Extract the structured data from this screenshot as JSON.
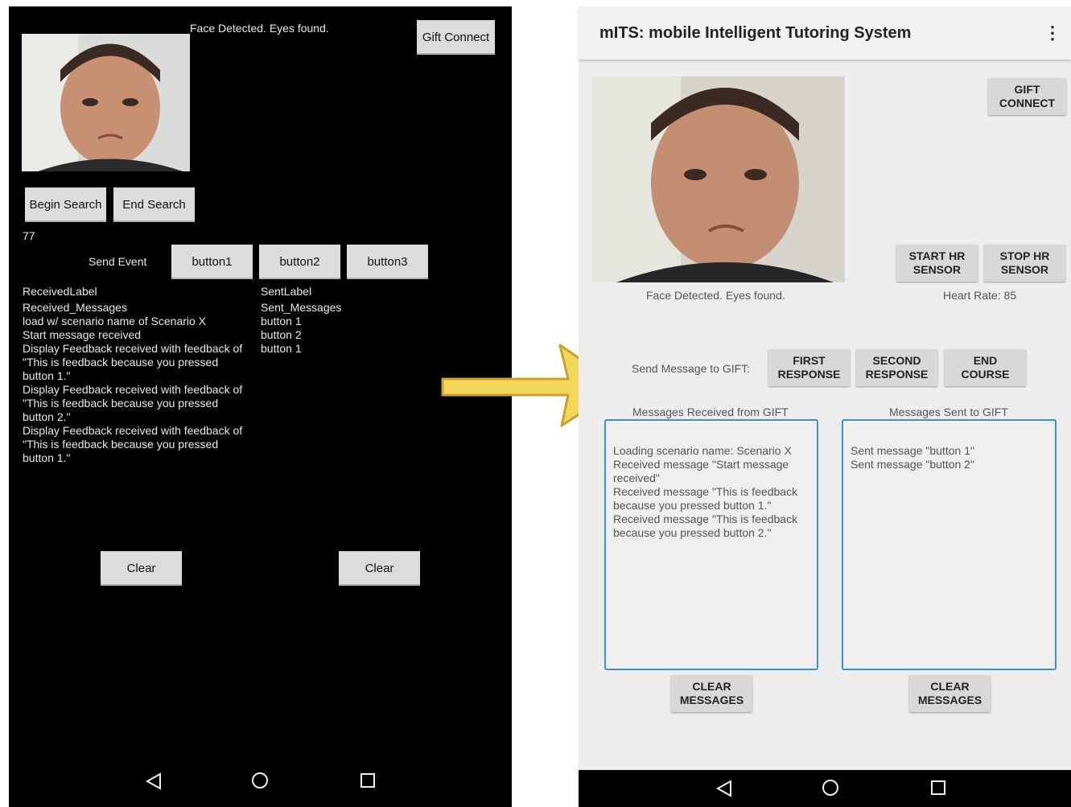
{
  "old_screen": {
    "status": "Face Detected. Eyes found.",
    "gift_connect": "Gift Connect",
    "begin_search": "Begin Search",
    "end_search": "End Search",
    "counter": "77",
    "send_event_label": "Send Event",
    "buttons": [
      "button1",
      "button2",
      "button3"
    ],
    "received_label": "ReceivedLabel",
    "received_lines": [
      "Received_Messages",
      "load w/ scenario name of Scenario X",
      "Start message received",
      "Display Feedback received with feedback of",
      "\"This is feedback because you pressed",
      "button 1.\"",
      "Display Feedback received with feedback of",
      "\"This is feedback because you pressed",
      "button 2.\"",
      "Display Feedback received with feedback of",
      "\"This is feedback because you pressed",
      "button 1.\""
    ],
    "sent_label": "SentLabel",
    "sent_lines": [
      "Sent_Messages",
      "button 1",
      "button 2",
      "button 1"
    ],
    "clear_left": "Clear",
    "clear_right": "Clear",
    "nav_icons": [
      "back-icon",
      "home-icon",
      "recents-icon"
    ]
  },
  "new_screen": {
    "app_title": "mITS: mobile Intelligent Tutoring System",
    "menu_icon": "overflow-menu-icon",
    "gift_connect": "GIFT\nCONNECT",
    "start_hr": "START HR\nSENSOR",
    "stop_hr": "STOP HR\nSENSOR",
    "face_status": "Face Detected. Eyes found.",
    "heart_rate": "Heart Rate: 85",
    "send_message_label": "Send Message to GIFT:",
    "first_response": "FIRST\nRESPONSE",
    "second_response": "SECOND\nRESPONSE",
    "end_course": "END\nCOURSE",
    "received_title": "Messages Received from GIFT",
    "received_lines": [
      "Loading scenario name: Scenario X",
      "Received message \"Start message",
      "received\"",
      "Received message \"This is feedback",
      "because you pressed button 1.\"",
      "Received message \"This is feedback",
      "because you pressed button 2.\""
    ],
    "sent_title": "Messages Sent to GIFT",
    "sent_lines": [
      "Sent message \"button 1\"",
      "Sent message \"button 2\""
    ],
    "clear_left": "CLEAR\nMESSAGES",
    "clear_right": "CLEAR\nMESSAGES",
    "nav_icons": [
      "back-icon",
      "home-icon",
      "recents-icon"
    ]
  },
  "colors": {
    "arrow_fill": "#f3d65a",
    "arrow_stroke": "#c9a227",
    "box_border": "#3b8fd0"
  }
}
